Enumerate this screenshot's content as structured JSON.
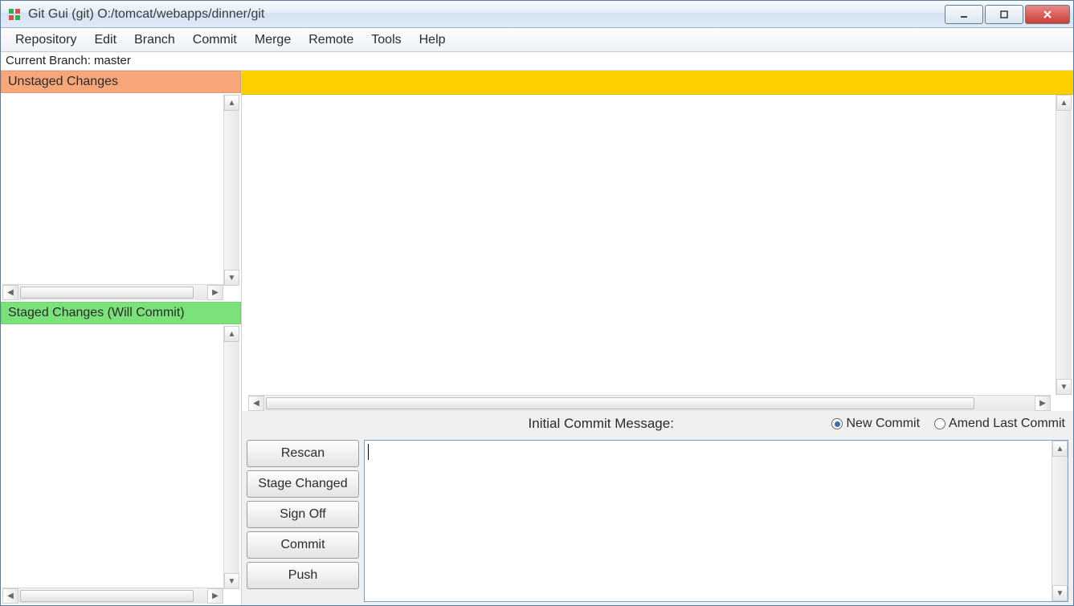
{
  "window": {
    "title": "Git Gui (git) O:/tomcat/webapps/dinner/git"
  },
  "menu": {
    "items": [
      "Repository",
      "Edit",
      "Branch",
      "Commit",
      "Merge",
      "Remote",
      "Tools",
      "Help"
    ]
  },
  "branch": {
    "label": "Current Branch: master"
  },
  "panels": {
    "unstaged": "Unstaged Changes",
    "staged": "Staged Changes (Will Commit)"
  },
  "commit": {
    "message_label": "Initial Commit Message:",
    "radio_new": "New Commit",
    "radio_amend": "Amend Last Commit",
    "selected_radio": "new"
  },
  "buttons": {
    "rescan": "Rescan",
    "stage_changed": "Stage Changed",
    "sign_off": "Sign Off",
    "commit": "Commit",
    "push": "Push"
  }
}
